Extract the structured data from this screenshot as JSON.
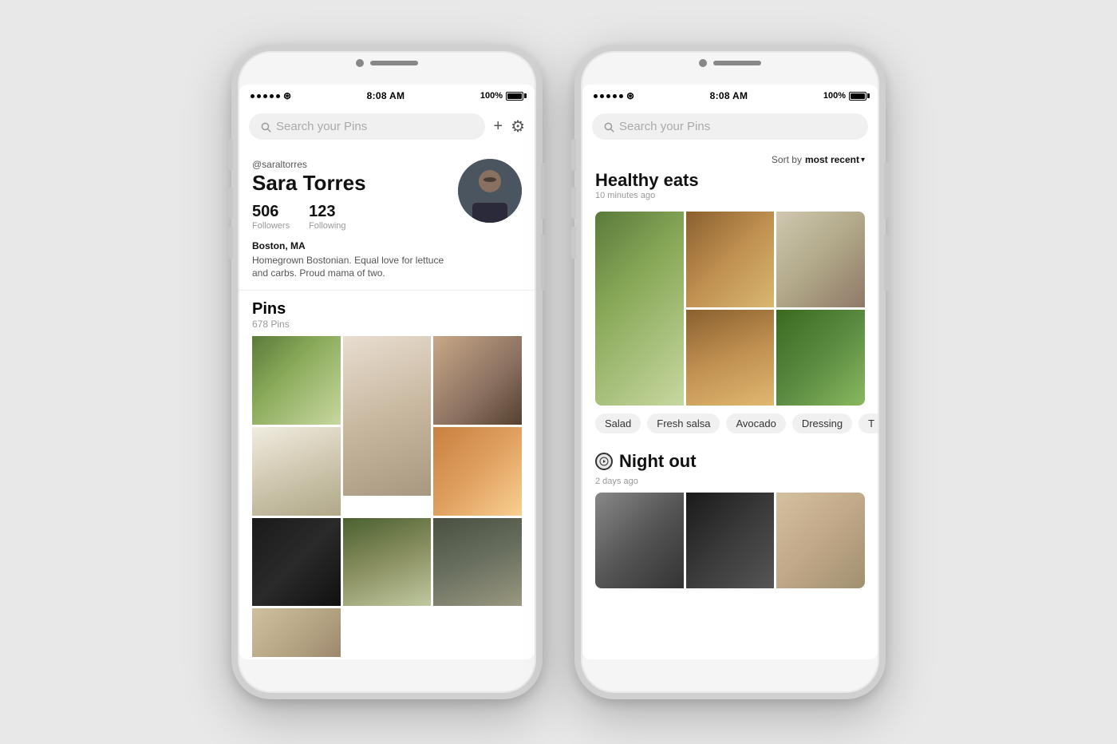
{
  "background_color": "#e8e8e8",
  "phones": [
    {
      "id": "left-phone",
      "status_bar": {
        "time": "8:08 AM",
        "battery": "100%",
        "signal_dots": 5,
        "wifi": true
      },
      "search": {
        "placeholder": "Search your Pins"
      },
      "toolbar": {
        "add_label": "+",
        "settings_label": "⚙"
      },
      "profile": {
        "username": "@saraltorres",
        "display_name": "Sara Torres",
        "followers_count": "506",
        "followers_label": "Followers",
        "following_count": "123",
        "following_label": "Following",
        "location": "Boston, MA",
        "bio": "Homegrown Bostonian. Equal love for lettuce and carbs. Proud mama of two."
      },
      "pins": {
        "heading": "Pins",
        "count": "678 Pins"
      }
    },
    {
      "id": "right-phone",
      "status_bar": {
        "time": "8:08 AM",
        "battery": "100%",
        "signal_dots": 5,
        "wifi": true
      },
      "search": {
        "placeholder": "Search your Pins"
      },
      "boards": [
        {
          "name": "Healthy eats",
          "time": "10 minutes ago",
          "sort_label": "Sort by",
          "sort_value": "most recent",
          "tags": [
            "Salad",
            "Fresh salsa",
            "Avocado",
            "Dressing",
            "T"
          ]
        },
        {
          "name": "Night out",
          "time": "2 days ago",
          "has_icon": true
        }
      ]
    }
  ]
}
